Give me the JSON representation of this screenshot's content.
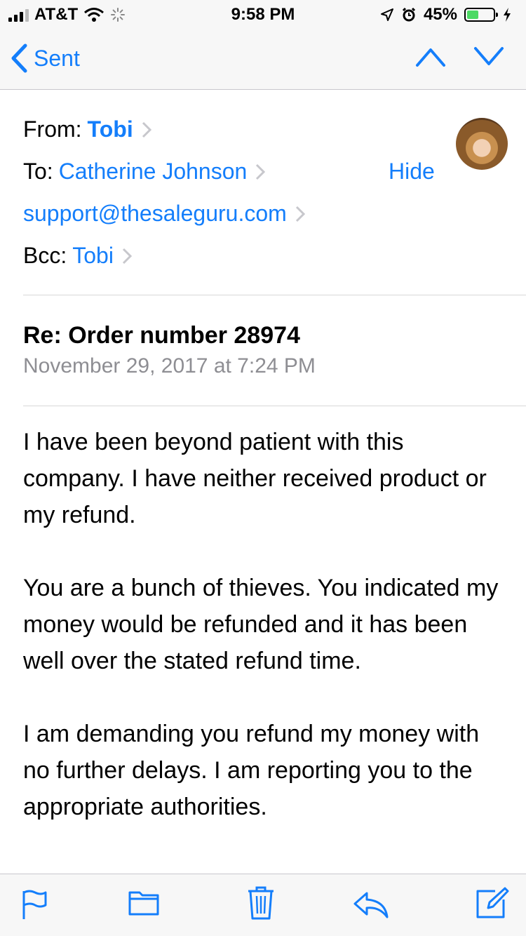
{
  "status_bar": {
    "carrier": "AT&T",
    "time": "9:58 PM",
    "battery_percent": "45%",
    "battery_level": 0.45
  },
  "nav": {
    "back_label": "Sent"
  },
  "header": {
    "from_label": "From:",
    "from_name": "Tobi",
    "to_label": "To:",
    "to_name": "Catherine Johnson",
    "to_email": "support@thesaleguru.com",
    "bcc_label": "Bcc:",
    "bcc_name": "Tobi",
    "hide_label": "Hide"
  },
  "message": {
    "subject": "Re: Order number 28974",
    "date": "November 29, 2017 at 7:24 PM",
    "paragraphs": [
      "I have been beyond patient with this company. I have neither received product or my refund.",
      "You are a bunch of thieves. You indicated my money would be refunded and it has been well over the stated refund time.",
      "I am demanding you refund my money with no further delays. I am reporting you to the appropriate authorities."
    ]
  },
  "colors": {
    "accent": "#147efb",
    "secondary_text": "#8e8e93",
    "battery_fill": "#4cd964"
  },
  "toolbar": {
    "icons": [
      "flag-icon",
      "folder-icon",
      "trash-icon",
      "reply-icon",
      "compose-icon"
    ]
  }
}
